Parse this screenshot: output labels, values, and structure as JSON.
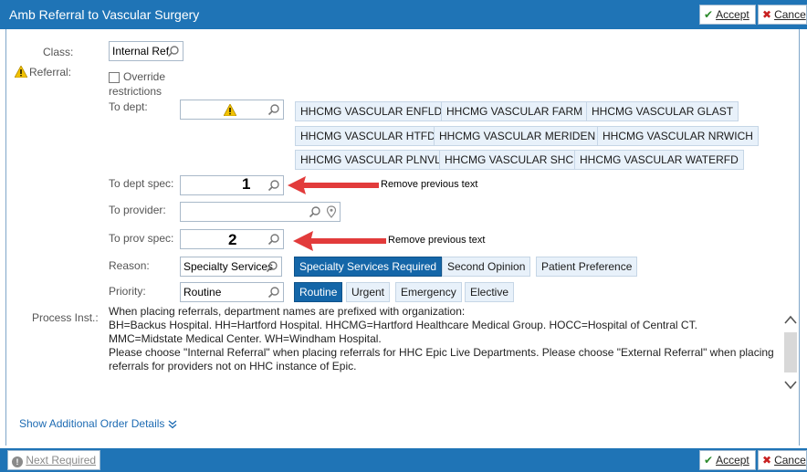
{
  "window": {
    "title": "Amb Referral to Vascular Surgery"
  },
  "actions": {
    "accept": "Accept",
    "cancel": "Cance"
  },
  "form": {
    "class": {
      "label": "Class:",
      "value": "Internal Ref"
    },
    "referral": {
      "label": "Referral:",
      "override_line1": "Override",
      "override_line2": "restrictions"
    },
    "to_dept": {
      "label": "To dept:"
    },
    "dept_chips": [
      "HHCMG VASCULAR ENFLD",
      "HHCMG VASCULAR FARM",
      "HHCMG VASCULAR GLAST",
      "HHCMG VASCULAR HTFD",
      "HHCMG VASCULAR MERIDEN",
      "HHCMG VASCULAR NRWICH",
      "HHCMG VASCULAR PLNVL",
      "HHCMG VASCULAR SHC",
      "HHCMG VASCULAR WATERFD"
    ],
    "to_dept_spec": {
      "label": "To dept spec:",
      "marker": "1",
      "note": "Remove previous text"
    },
    "to_provider": {
      "label": "To provider:"
    },
    "to_prov_spec": {
      "label": "To prov spec:",
      "marker": "2",
      "note": "Remove previous text"
    },
    "reason": {
      "label": "Reason:",
      "value": "Specialty Services",
      "options": [
        "Specialty Services Required",
        "Second Opinion",
        "Patient Preference"
      ],
      "selected": "Specialty Services Required"
    },
    "priority": {
      "label": "Priority:",
      "value": "Routine",
      "options": [
        "Routine",
        "Urgent",
        "Emergency",
        "Elective"
      ],
      "selected": "Routine"
    },
    "process_inst": {
      "label": "Process Inst.:",
      "lines": [
        "When placing referrals, department names are prefixed with organization:",
        "BH=Backus Hospital.  HH=Hartford Hospital.  HHCMG=Hartford Healthcare Medical Group.  HOCC=Hospital of Central CT.",
        "MMC=Midstate Medical Center.  WH=Windham Hospital.",
        "Please choose \"Internal Referral\" when placing referrals for HHC Epic Live Departments.  Please choose \"External Referral\" when placing",
        "referrals for providers not on HHC instance of Epic."
      ]
    }
  },
  "links": {
    "show_additional": "Show Additional Order Details"
  },
  "footer": {
    "next_required": "Next Required"
  },
  "colors": {
    "header": "#1f74b6",
    "chip_bg": "#e8f1fa",
    "chip_selected": "#1466a8",
    "arrow": "#e23b3b",
    "warning": "#f2c200"
  }
}
